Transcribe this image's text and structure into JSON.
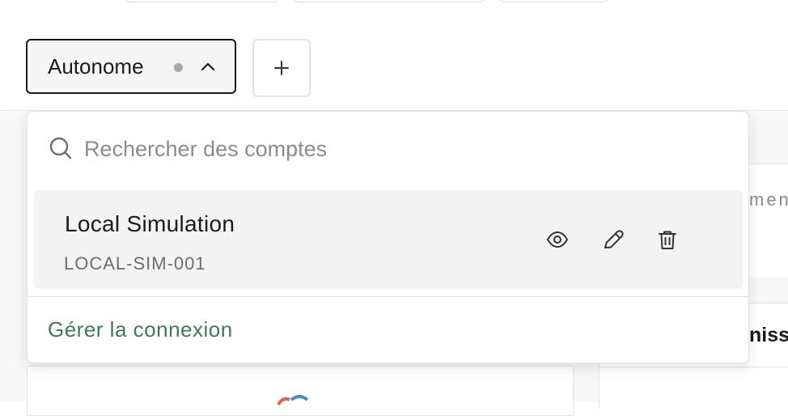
{
  "toolbar": {
    "account_label": "Autonome",
    "status_color": "#a8a8a8",
    "chevron_icon": "chevron-up-icon",
    "add_icon": "plus-icon"
  },
  "dropdown": {
    "search": {
      "placeholder": "Rechercher des comptes",
      "value": ""
    },
    "accounts": [
      {
        "name": "Local Simulation",
        "id": "LOCAL-SIM-001",
        "actions": [
          "eye-icon",
          "pencil-icon",
          "trash-icon"
        ]
      }
    ],
    "manage_label": "Gérer la connexion",
    "link_color": "#3f7a56"
  },
  "background": {
    "partial_text_a": "men",
    "partial_text_b": "niss"
  }
}
